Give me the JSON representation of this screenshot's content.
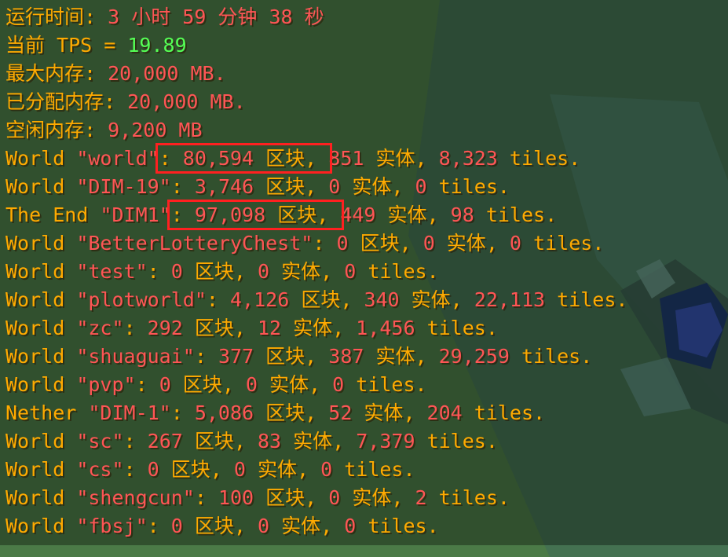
{
  "status": {
    "uptime_label": "运行时间: ",
    "uptime_value": "3 小时 59 分钟 38 秒",
    "tps_label": "当前 TPS = ",
    "tps_value": "19.89",
    "max_mem_label": "最大内存: ",
    "max_mem_value": "20,000 MB.",
    "alloc_mem_label": "已分配内存: ",
    "alloc_mem_value": "20,000 MB.",
    "free_mem_label": "空闲内存: ",
    "free_mem_value": "9,200 MB"
  },
  "worlds": [
    {
      "prefix": "World ",
      "name": "\"world\"",
      "colon": ": ",
      "chunks": "80,594",
      "chunks_unit": " 区块",
      "comma1": ", ",
      "entities": "851",
      "entities_unit": " 实体",
      "comma2": ", ",
      "tiles": "8,323",
      "tiles_unit": " tiles.",
      "highlight": true
    },
    {
      "prefix": "World ",
      "name": "\"DIM-19\"",
      "colon": ": ",
      "chunks": "3,746",
      "chunks_unit": " 区块",
      "comma1": ", ",
      "entities": "0",
      "entities_unit": " 实体",
      "comma2": ", ",
      "tiles": "0",
      "tiles_unit": " tiles.",
      "highlight": false
    },
    {
      "prefix": "The End ",
      "name": "\"DIM1\"",
      "colon": ": ",
      "chunks": "97,098",
      "chunks_unit": " 区块",
      "comma1": ", ",
      "entities": "449",
      "entities_unit": " 实体",
      "comma2": ", ",
      "tiles": "98",
      "tiles_unit": " tiles.",
      "highlight": true
    },
    {
      "prefix": "World ",
      "name": "\"BetterLotteryChest\"",
      "colon": ": ",
      "chunks": "0",
      "chunks_unit": " 区块",
      "comma1": ", ",
      "entities": "0",
      "entities_unit": " 实体",
      "comma2": ", ",
      "tiles": "0",
      "tiles_unit": " tiles.",
      "highlight": false
    },
    {
      "prefix": "World ",
      "name": "\"test\"",
      "colon": ": ",
      "chunks": "0",
      "chunks_unit": " 区块",
      "comma1": ", ",
      "entities": "0",
      "entities_unit": " 实体",
      "comma2": ", ",
      "tiles": "0",
      "tiles_unit": " tiles.",
      "highlight": false
    },
    {
      "prefix": "World ",
      "name": "\"plotworld\"",
      "colon": ": ",
      "chunks": "4,126",
      "chunks_unit": " 区块",
      "comma1": ", ",
      "entities": "340",
      "entities_unit": " 实体",
      "comma2": ", ",
      "tiles": "22,113",
      "tiles_unit": " tiles.",
      "highlight": false
    },
    {
      "prefix": "World ",
      "name": "\"zc\"",
      "colon": ": ",
      "chunks": "292",
      "chunks_unit": " 区块",
      "comma1": ", ",
      "entities": "12",
      "entities_unit": " 实体",
      "comma2": ", ",
      "tiles": "1,456",
      "tiles_unit": " tiles.",
      "highlight": false
    },
    {
      "prefix": "World ",
      "name": "\"shuaguai\"",
      "colon": ": ",
      "chunks": "377",
      "chunks_unit": " 区块",
      "comma1": ", ",
      "entities": "387",
      "entities_unit": " 实体",
      "comma2": ", ",
      "tiles": "29,259",
      "tiles_unit": " tiles.",
      "highlight": false
    },
    {
      "prefix": "World ",
      "name": "\"pvp\"",
      "colon": ": ",
      "chunks": "0",
      "chunks_unit": " 区块",
      "comma1": ", ",
      "entities": "0",
      "entities_unit": " 实体",
      "comma2": ", ",
      "tiles": "0",
      "tiles_unit": " tiles.",
      "highlight": false
    },
    {
      "prefix": "Nether ",
      "name": "\"DIM-1\"",
      "colon": ": ",
      "chunks": "5,086",
      "chunks_unit": " 区块",
      "comma1": ", ",
      "entities": "52",
      "entities_unit": " 实体",
      "comma2": ", ",
      "tiles": "204",
      "tiles_unit": " tiles.",
      "highlight": false
    },
    {
      "prefix": "World ",
      "name": "\"sc\"",
      "colon": ": ",
      "chunks": "267",
      "chunks_unit": " 区块",
      "comma1": ", ",
      "entities": "83",
      "entities_unit": " 实体",
      "comma2": ", ",
      "tiles": "7,379",
      "tiles_unit": " tiles.",
      "highlight": false
    },
    {
      "prefix": "World ",
      "name": "\"cs\"",
      "colon": ": ",
      "chunks": "0",
      "chunks_unit": " 区块",
      "comma1": ", ",
      "entities": "0",
      "entities_unit": " 实体",
      "comma2": ", ",
      "tiles": "0",
      "tiles_unit": " tiles.",
      "highlight": false
    },
    {
      "prefix": "World ",
      "name": "\"shengcun\"",
      "colon": ": ",
      "chunks": "100",
      "chunks_unit": " 区块",
      "comma1": ", ",
      "entities": "0",
      "entities_unit": " 实体",
      "comma2": ", ",
      "tiles": "2",
      "tiles_unit": " tiles.",
      "highlight": false
    },
    {
      "prefix": "World ",
      "name": "\"fbsj\"",
      "colon": ": ",
      "chunks": "0",
      "chunks_unit": " 区块",
      "comma1": ", ",
      "entities": "0",
      "entities_unit": " 实体",
      "comma2": ", ",
      "tiles": "0",
      "tiles_unit": " tiles.",
      "highlight": false
    }
  ],
  "colors": {
    "label": "#ffaa00",
    "value": "#ff5555",
    "tps": "#55ff55",
    "highlight_box": "#ff2020"
  }
}
